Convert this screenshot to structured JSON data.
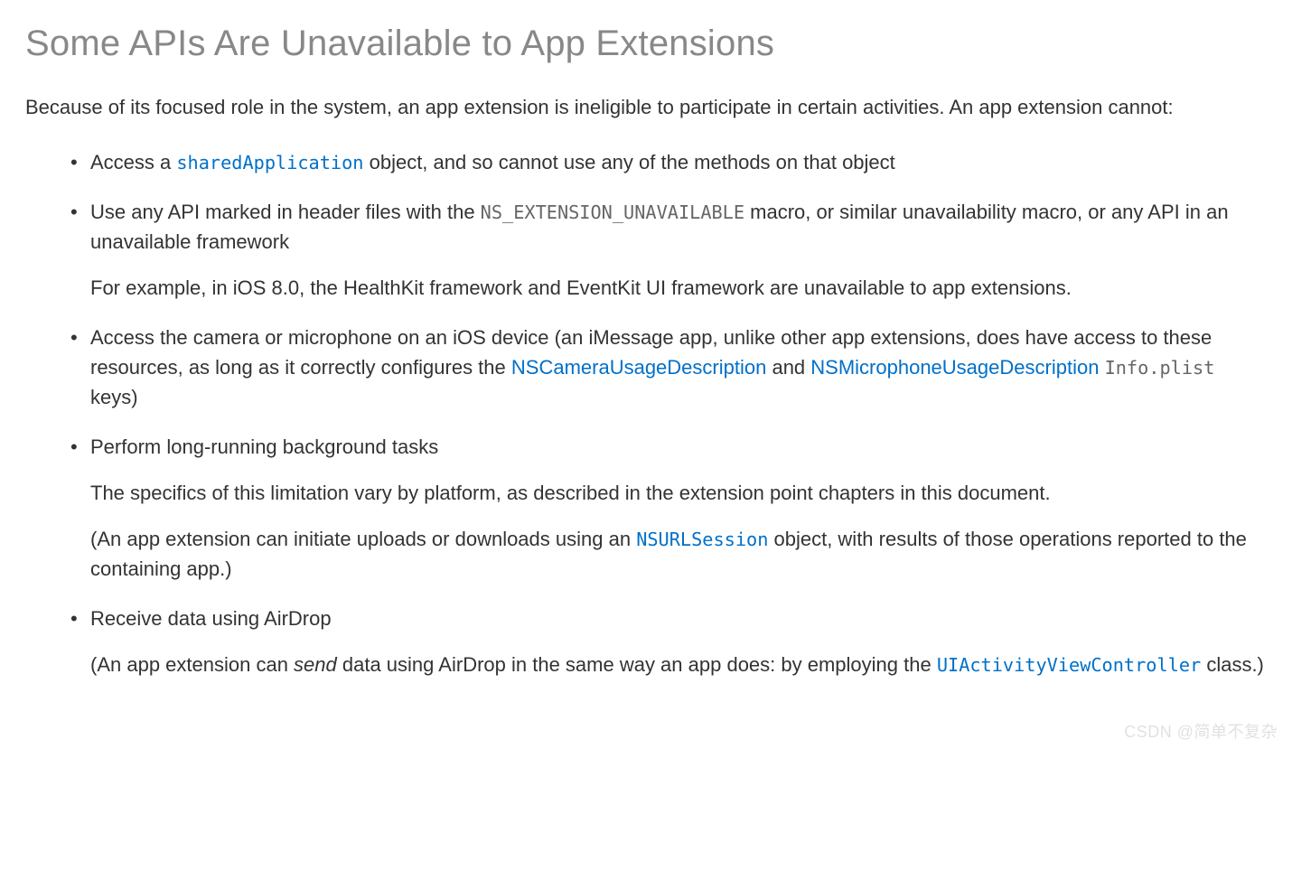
{
  "heading": "Some APIs Are Unavailable to App Extensions",
  "intro": "Because of its focused role in the system, an app extension is ineligible to participate in certain activities. An app extension cannot:",
  "items": {
    "i1": {
      "t1": "Access a ",
      "code1": "sharedApplication",
      "t2": " object, and so cannot use any of the methods on that object"
    },
    "i2": {
      "t1": "Use any API marked in header files with the ",
      "code1": "NS_EXTENSION_UNAVAILABLE",
      "t2": " macro, or similar unavailability macro, or any API in an unavailable framework",
      "p2": "For example, in iOS 8.0, the HealthKit framework and EventKit UI framework are unavailable to app extensions."
    },
    "i3": {
      "t1": "Access the camera or microphone on an iOS device (an iMessage app, unlike other app extensions, does have access to these resources, as long as it correctly configures the ",
      "link1": "NSCameraUsageDescription",
      "t2": " and ",
      "link2": "NSMicrophoneUsageDescription",
      "t3": " ",
      "code1": "Info.plist",
      "t4": " keys)"
    },
    "i4": {
      "t1": "Perform long-running background tasks",
      "p2": "The specifics of this limitation vary by platform, as described in the extension point chapters in this document.",
      "p3a": "(An app extension can initiate uploads or downloads using an ",
      "code1": "NSURLSession",
      "p3b": " object, with results of those operations reported to the containing app.)"
    },
    "i5": {
      "t1": "Receive data using AirDrop",
      "p2a": "(An app extension can ",
      "p2em": "send",
      "p2b": " data using AirDrop in the same way an app does: by employing the ",
      "code1": "UIActivityViewController",
      "p2c": " class.)"
    }
  },
  "watermark": "CSDN @简单不复杂"
}
